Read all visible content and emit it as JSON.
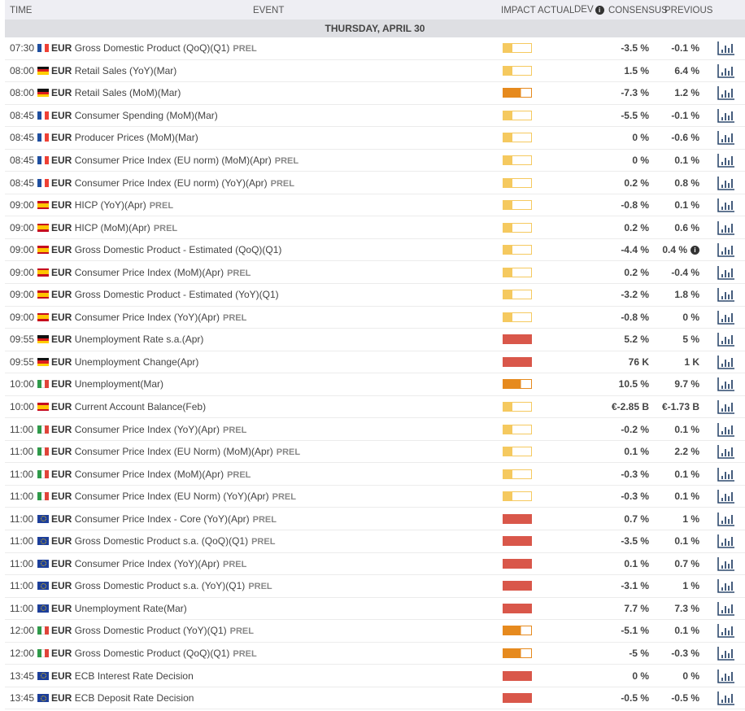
{
  "header": {
    "time": "TIME",
    "event": "EVENT",
    "impact": "IMPACT",
    "actual": "ACTUAL",
    "dev": "DEV",
    "consensus": "CONSENSUS",
    "previous": "PREVIOUS",
    "info_glyph": "i"
  },
  "date_label": "THURSDAY, APRIL 30",
  "colors": {
    "low": "#f5c95f",
    "medium": "#e68a1e",
    "high": "#d9574a",
    "chart_icon": "#2f4a6e"
  },
  "rows": [
    {
      "time": "07:30",
      "flag": "fr",
      "cur": "EUR",
      "name": "Gross Domestic Product (QoQ)(Q1)",
      "prel": "PREL",
      "impact": "low",
      "consensus": "-3.5 %",
      "previous": "-0.1 %"
    },
    {
      "time": "08:00",
      "flag": "de",
      "cur": "EUR",
      "name": "Retail Sales (YoY)(Mar)",
      "prel": "",
      "impact": "low",
      "consensus": "1.5 %",
      "previous": "6.4 %"
    },
    {
      "time": "08:00",
      "flag": "de",
      "cur": "EUR",
      "name": "Retail Sales (MoM)(Mar)",
      "prel": "",
      "impact": "med",
      "consensus": "-7.3 %",
      "previous": "1.2 %"
    },
    {
      "time": "08:45",
      "flag": "fr",
      "cur": "EUR",
      "name": "Consumer Spending (MoM)(Mar)",
      "prel": "",
      "impact": "low",
      "consensus": "-5.5 %",
      "previous": "-0.1 %"
    },
    {
      "time": "08:45",
      "flag": "fr",
      "cur": "EUR",
      "name": "Producer Prices (MoM)(Mar)",
      "prel": "",
      "impact": "low",
      "consensus": "0 %",
      "previous": "-0.6 %"
    },
    {
      "time": "08:45",
      "flag": "fr",
      "cur": "EUR",
      "name": "Consumer Price Index (EU norm) (MoM)(Apr)",
      "prel": "PREL",
      "impact": "low",
      "consensus": "0 %",
      "previous": "0.1 %"
    },
    {
      "time": "08:45",
      "flag": "fr",
      "cur": "EUR",
      "name": "Consumer Price Index (EU norm) (YoY)(Apr)",
      "prel": "PREL",
      "impact": "low",
      "consensus": "0.2 %",
      "previous": "0.8 %"
    },
    {
      "time": "09:00",
      "flag": "es",
      "cur": "EUR",
      "name": "HICP (YoY)(Apr)",
      "prel": "PREL",
      "impact": "low",
      "consensus": "-0.8 %",
      "previous": "0.1 %"
    },
    {
      "time": "09:00",
      "flag": "es",
      "cur": "EUR",
      "name": "HICP (MoM)(Apr)",
      "prel": "PREL",
      "impact": "low",
      "consensus": "0.2 %",
      "previous": "0.6 %"
    },
    {
      "time": "09:00",
      "flag": "es",
      "cur": "EUR",
      "name": "Gross Domestic Product - Estimated (QoQ)(Q1)",
      "prel": "",
      "impact": "low",
      "consensus": "-4.4 %",
      "previous": "0.4 %",
      "info": true
    },
    {
      "time": "09:00",
      "flag": "es",
      "cur": "EUR",
      "name": "Consumer Price Index (MoM)(Apr)",
      "prel": "PREL",
      "impact": "low",
      "consensus": "0.2 %",
      "previous": "-0.4 %"
    },
    {
      "time": "09:00",
      "flag": "es",
      "cur": "EUR",
      "name": "Gross Domestic Product - Estimated (YoY)(Q1)",
      "prel": "",
      "impact": "low",
      "consensus": "-3.2 %",
      "previous": "1.8 %"
    },
    {
      "time": "09:00",
      "flag": "es",
      "cur": "EUR",
      "name": "Consumer Price Index (YoY)(Apr)",
      "prel": "PREL",
      "impact": "low",
      "consensus": "-0.8 %",
      "previous": "0 %"
    },
    {
      "time": "09:55",
      "flag": "de",
      "cur": "EUR",
      "name": "Unemployment Rate s.a.(Apr)",
      "prel": "",
      "impact": "high",
      "consensus": "5.2 %",
      "previous": "5 %"
    },
    {
      "time": "09:55",
      "flag": "de",
      "cur": "EUR",
      "name": "Unemployment Change(Apr)",
      "prel": "",
      "impact": "high",
      "consensus": "76 K",
      "previous": "1 K"
    },
    {
      "time": "10:00",
      "flag": "it",
      "cur": "EUR",
      "name": "Unemployment(Mar)",
      "prel": "",
      "impact": "med",
      "consensus": "10.5 %",
      "previous": "9.7 %"
    },
    {
      "time": "10:00",
      "flag": "es",
      "cur": "EUR",
      "name": "Current Account Balance(Feb)",
      "prel": "",
      "impact": "low",
      "consensus": "€-2.85 B",
      "previous": "€-1.73 B"
    },
    {
      "time": "11:00",
      "flag": "it",
      "cur": "EUR",
      "name": "Consumer Price Index (YoY)(Apr)",
      "prel": "PREL",
      "impact": "low",
      "consensus": "-0.2 %",
      "previous": "0.1 %"
    },
    {
      "time": "11:00",
      "flag": "it",
      "cur": "EUR",
      "name": "Consumer Price Index (EU Norm) (MoM)(Apr)",
      "prel": "PREL",
      "impact": "low",
      "consensus": "0.1 %",
      "previous": "2.2 %"
    },
    {
      "time": "11:00",
      "flag": "it",
      "cur": "EUR",
      "name": "Consumer Price Index (MoM)(Apr)",
      "prel": "PREL",
      "impact": "low",
      "consensus": "-0.3 %",
      "previous": "0.1 %"
    },
    {
      "time": "11:00",
      "flag": "it",
      "cur": "EUR",
      "name": "Consumer Price Index (EU Norm) (YoY)(Apr)",
      "prel": "PREL",
      "impact": "low",
      "consensus": "-0.3 %",
      "previous": "0.1 %"
    },
    {
      "time": "11:00",
      "flag": "eu",
      "cur": "EUR",
      "name": "Consumer Price Index - Core (YoY)(Apr)",
      "prel": "PREL",
      "impact": "high",
      "consensus": "0.7 %",
      "previous": "1 %"
    },
    {
      "time": "11:00",
      "flag": "eu",
      "cur": "EUR",
      "name": "Gross Domestic Product s.a. (QoQ)(Q1)",
      "prel": "PREL",
      "impact": "high",
      "consensus": "-3.5 %",
      "previous": "0.1 %"
    },
    {
      "time": "11:00",
      "flag": "eu",
      "cur": "EUR",
      "name": "Consumer Price Index (YoY)(Apr)",
      "prel": "PREL",
      "impact": "high",
      "consensus": "0.1 %",
      "previous": "0.7 %"
    },
    {
      "time": "11:00",
      "flag": "eu",
      "cur": "EUR",
      "name": "Gross Domestic Product s.a. (YoY)(Q1)",
      "prel": "PREL",
      "impact": "high",
      "consensus": "-3.1 %",
      "previous": "1 %"
    },
    {
      "time": "11:00",
      "flag": "eu",
      "cur": "EUR",
      "name": "Unemployment Rate(Mar)",
      "prel": "",
      "impact": "high",
      "consensus": "7.7 %",
      "previous": "7.3 %"
    },
    {
      "time": "12:00",
      "flag": "it",
      "cur": "EUR",
      "name": "Gross Domestic Product (YoY)(Q1)",
      "prel": "PREL",
      "impact": "med",
      "consensus": "-5.1 %",
      "previous": "0.1 %"
    },
    {
      "time": "12:00",
      "flag": "it",
      "cur": "EUR",
      "name": "Gross Domestic Product (QoQ)(Q1)",
      "prel": "PREL",
      "impact": "med",
      "consensus": "-5 %",
      "previous": "-0.3 %"
    },
    {
      "time": "13:45",
      "flag": "eu",
      "cur": "EUR",
      "name": "ECB Interest Rate Decision",
      "prel": "",
      "impact": "high",
      "consensus": "0 %",
      "previous": "0 %"
    },
    {
      "time": "13:45",
      "flag": "eu",
      "cur": "EUR",
      "name": "ECB Deposit Rate Decision",
      "prel": "",
      "impact": "high",
      "consensus": "-0.5 %",
      "previous": "-0.5 %"
    }
  ]
}
